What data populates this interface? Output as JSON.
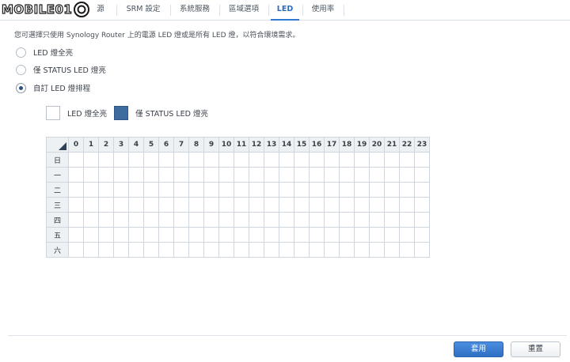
{
  "watermark": {
    "text": "MOBILE01"
  },
  "tabs": [
    {
      "label": "源",
      "active": false
    },
    {
      "label": "SRM 設定",
      "active": false
    },
    {
      "label": "系統服務",
      "active": false
    },
    {
      "label": "區域選項",
      "active": false
    },
    {
      "label": "LED",
      "active": true
    },
    {
      "label": "使用率",
      "active": false
    }
  ],
  "description": "您可選擇只使用 Synology Router 上的電源 LED 燈或是所有 LED 燈，以符合環境需求。",
  "options": [
    {
      "label": "LED 燈全亮",
      "checked": false
    },
    {
      "label": "僅 STATUS LED 燈亮",
      "checked": false
    },
    {
      "label": "自訂 LED 燈排程",
      "checked": true
    }
  ],
  "legend": {
    "all_on_label": "LED 燈全亮",
    "status_only_label": "僅 STATUS LED 燈亮",
    "status_only_color": "#3f6c9f"
  },
  "schedule": {
    "hours": [
      "0",
      "1",
      "2",
      "3",
      "4",
      "5",
      "6",
      "7",
      "8",
      "9",
      "10",
      "11",
      "12",
      "13",
      "14",
      "15",
      "16",
      "17",
      "18",
      "19",
      "20",
      "21",
      "22",
      "23"
    ],
    "days": [
      "日",
      "一",
      "二",
      "三",
      "四",
      "五",
      "六"
    ]
  },
  "footer": {
    "apply_label": "套用",
    "reset_label": "重置",
    "accent_color": "#2f6fc4"
  }
}
